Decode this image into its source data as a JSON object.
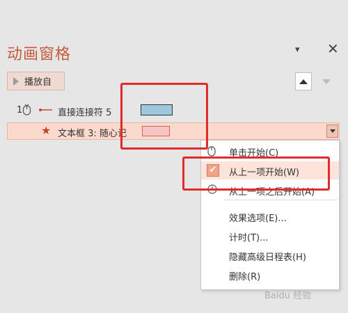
{
  "panel": {
    "title": "动画窗格",
    "play_button": "播放自",
    "dropdown_icon": "▾",
    "close_icon": "✕"
  },
  "animations": [
    {
      "order": "1",
      "label": "直接连接符 5",
      "bar_color": "#9cc7dc",
      "trigger_icon": "mouse-click-icon",
      "effect_icon": "connector-line-icon"
    },
    {
      "order": "",
      "label": "文本框 3: 随心记",
      "bar_color": "#f6c4c2",
      "effect_icon": "star-icon",
      "selected": true
    }
  ],
  "context_menu": {
    "items": [
      {
        "label": "单击开始(C)",
        "icon": "mouse-icon"
      },
      {
        "label": "从上一项开始(W)",
        "icon": "check-icon",
        "checked": true
      },
      {
        "label": "从上一项之后开始(A)",
        "icon": "clock-icon"
      },
      {
        "label": "效果选项(E)..."
      },
      {
        "label": "计时(T)..."
      },
      {
        "label": "隐藏高级日程表(H)"
      },
      {
        "label": "删除(R)"
      }
    ]
  },
  "watermark": "Baidu 经验",
  "colors": {
    "title": "#c55a3c",
    "selected_row": "#fbd9cd",
    "annotation": "#e12a2a"
  }
}
